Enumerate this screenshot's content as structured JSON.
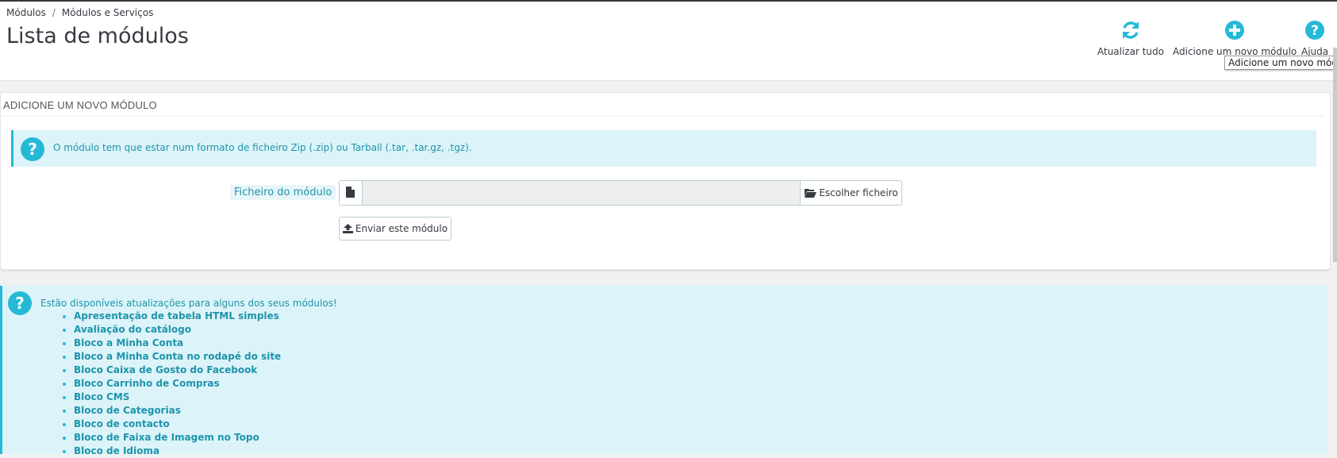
{
  "breadcrumb": {
    "parent": "Módulos",
    "separator": "/",
    "current": "Módulos e Serviços"
  },
  "page_title": "Lista de módulos",
  "toolbar": {
    "refresh_label": "Atualizar tudo",
    "add_label": "Adicione um novo módulo",
    "help_label": "Ajuda",
    "tooltip": "Adicione um novo módulo"
  },
  "panel": {
    "heading": "Adicione um novo módulo",
    "info": "O módulo tem que estar num formato de ficheiro Zip (.zip) ou Tarball (.tar, .tar.gz, .tgz).",
    "file_label": "Ficheiro do módulo",
    "file_value": "",
    "choose_label": "Escolher ficheiro",
    "upload_label": "Enviar este módulo"
  },
  "updates": {
    "intro": "Estão disponíveis atualizações para alguns dos seus módulos!",
    "modules": [
      "Apresentação de tabela HTML simples",
      "Avaliação do catálogo",
      "Bloco a Minha Conta",
      "Bloco a Minha Conta no rodapé do site",
      "Bloco Caixa de Gosto do Facebook",
      "Bloco Carrinho de Compras",
      "Bloco CMS",
      "Bloco de Categorias",
      "Bloco de contacto",
      "Bloco de Faixa de Imagem no Topo",
      "Bloco de Idioma"
    ]
  },
  "colors": {
    "accent": "#25b9d7",
    "info_bg": "#dcf4f9",
    "text_dark": "#363a41"
  },
  "icons": [
    "refresh-icon",
    "add-circle-icon",
    "help-circle-icon",
    "question-icon",
    "file-icon",
    "folder-open-icon",
    "upload-icon"
  ]
}
